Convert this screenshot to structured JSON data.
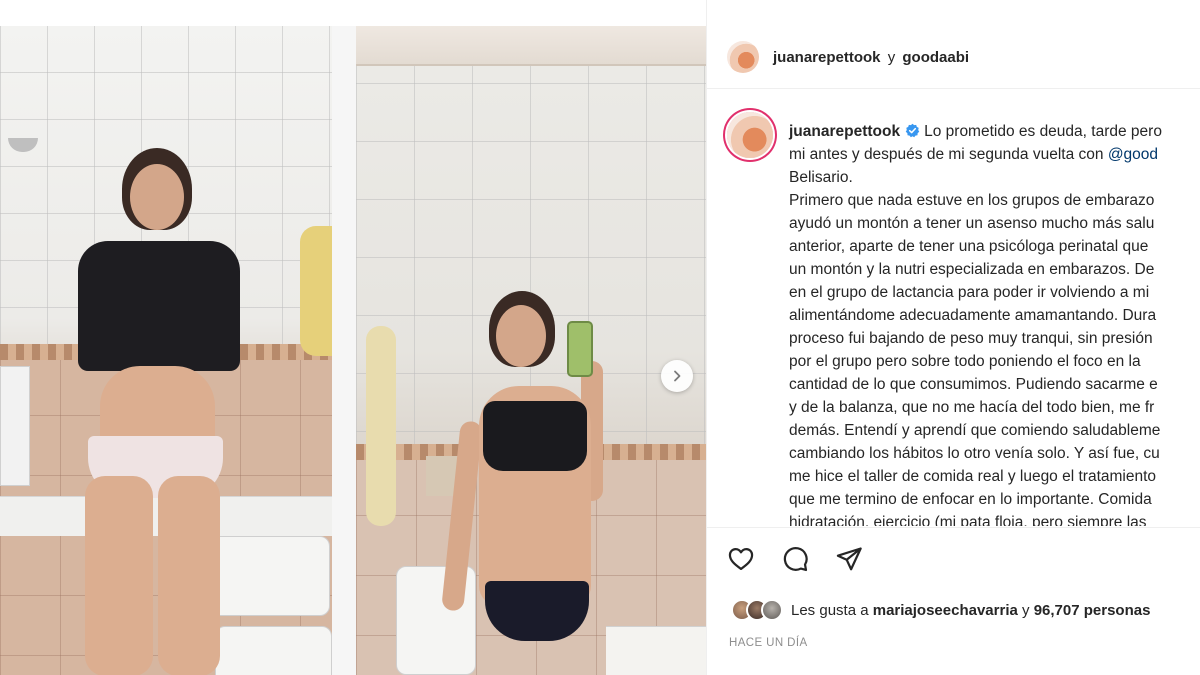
{
  "post": {
    "header": {
      "user1": "juanarepettook",
      "joiner": "y",
      "user2": "goodaabi"
    },
    "caption": {
      "username": "juanarepettook",
      "lines": [
        "Lo prometido es deuda, tarde pero",
        "mi antes y después de mi segunda vuelta con",
        "Belisario.",
        "Primero que nada estuve en los grupos de embarazo",
        "ayudó un montón a tener un asenso mucho más salu",
        "anterior, aparte de tener una psicóloga perinatal que",
        "un montón y la nutri especializada en embarazos. De",
        "en el grupo de lactancia para poder ir volviendo a mi",
        "alimentándome adecuadamente amamantando. Dura",
        "proceso fui bajando de peso muy tranqui, sin presión",
        "por el grupo pero sobre todo poniendo el foco en la",
        "cantidad de lo que consumimos. Pudiendo sacarme e",
        "y de la balanza, que no me hacía del todo bien, me fr",
        "demás. Entendí y aprendí que comiendo saludableme",
        "cambiando los hábitos lo otro venía solo. Y así fue, cu",
        "me hice el taller de comida real y luego el tratamiento",
        "que me termino de enfocar en lo importante. Comida",
        "hidratación, ejercicio (mi pata floja, pero siempre las"
      ],
      "mention": "@good"
    },
    "likes": {
      "prefix": "Les gusta a",
      "user": "mariajoseechavarria",
      "joiner": "y",
      "count_text": "96,707 personas"
    },
    "timestamp": "HACE UN DÍA",
    "icons": {
      "like": "heart-icon",
      "comment": "comment-icon",
      "share": "share-icon",
      "next": "chevron-right-icon",
      "verified": "verified-badge-icon"
    },
    "colors": {
      "verified": "#3897f0",
      "story_ring": "#e1306c",
      "mention": "#00376b",
      "muted": "#8e8e8e"
    }
  }
}
